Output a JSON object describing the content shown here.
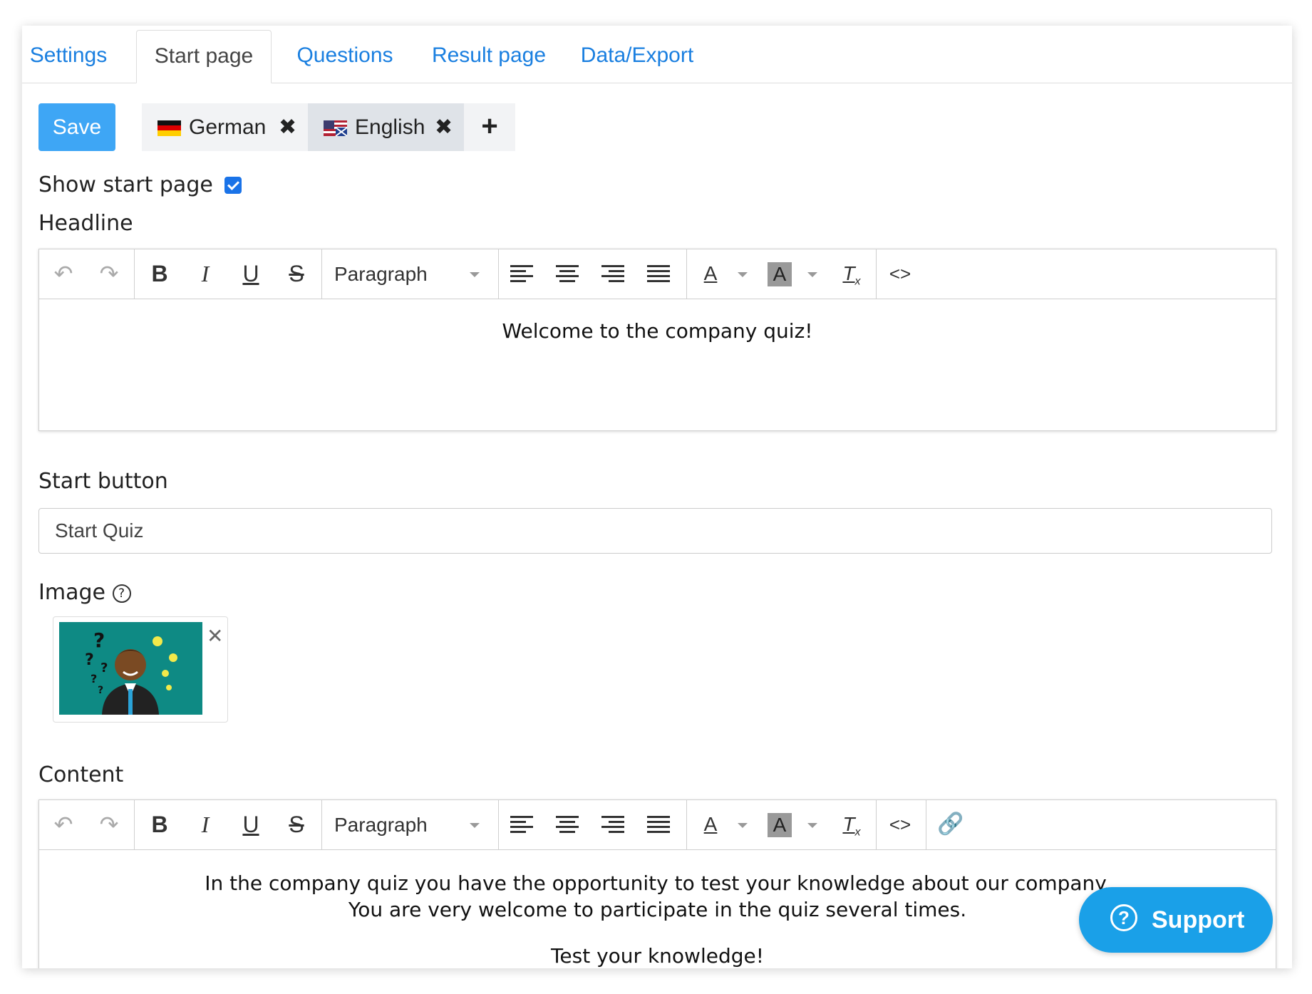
{
  "tabs": [
    {
      "label": "Settings",
      "active": false
    },
    {
      "label": "Start page",
      "active": true
    },
    {
      "label": "Questions",
      "active": false
    },
    {
      "label": "Result page",
      "active": false
    },
    {
      "label": "Data/Export",
      "active": false
    }
  ],
  "toolbar": {
    "save_label": "Save"
  },
  "languages": [
    {
      "label": "German",
      "flag": "de-flag",
      "active": false
    },
    {
      "label": "English",
      "flag": "us-uk-flag",
      "active": true
    }
  ],
  "show_start_page": {
    "label": "Show start page",
    "checked": true
  },
  "headline": {
    "label": "Headline",
    "format_label": "Paragraph",
    "text": "Welcome to the company quiz!"
  },
  "start_button": {
    "label": "Start button",
    "value": "Start Quiz"
  },
  "image": {
    "label": "Image",
    "help_icon": "question-circle-icon"
  },
  "content": {
    "label": "Content",
    "format_label": "Paragraph",
    "lines": [
      "In the company quiz you have the opportunity to test your knowledge about our company.",
      "You are very welcome to participate in the quiz several times.",
      "Test your knowledge!"
    ]
  },
  "support": {
    "label": "Support"
  },
  "colors": {
    "accent": "#1a7fe0",
    "save": "#3ea6f5",
    "support": "#1aa0e8",
    "checkbox": "#1a73e8",
    "image_bg": "#0e8a84"
  }
}
